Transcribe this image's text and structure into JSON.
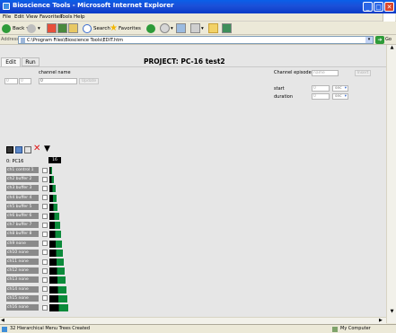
{
  "window": {
    "title": "Bioscience Tools - Microsoft Internet Explorer"
  },
  "menu": [
    "File",
    "Edit",
    "View",
    "Favorites",
    "Tools",
    "Help"
  ],
  "toolbar": {
    "back": "Back",
    "search": "Search",
    "favorites": "Favorites"
  },
  "address": {
    "label": "Address",
    "url": "C:\\Program Files\\Bioscience Tools\\EDIT.htm",
    "go": "Go",
    "links": "Links"
  },
  "tabs": [
    {
      "label": "Edit"
    },
    {
      "label": "Run"
    }
  ],
  "project_title": "PROJECT: PC-16 test2",
  "channel": {
    "name_label": "channel name",
    "field1": "0",
    "field2": "0",
    "field3": "0",
    "update_button": "Update"
  },
  "episode": {
    "label": "Channel episode",
    "name_placeholder": "name",
    "insert_button": "Insert",
    "start_label": "start",
    "start_value": "0",
    "duration_label": "duration",
    "duration_value": "0",
    "unit": "sec"
  },
  "tree": {
    "root_label": "0: PC16",
    "root_badge": "16",
    "channels": [
      {
        "label": "ch1 control 1",
        "level": 0.15
      },
      {
        "label": "ch2 buffer 2",
        "level": 0.22
      },
      {
        "label": "ch3 buffer 3",
        "level": 0.3
      },
      {
        "label": "ch4 buffer 4",
        "level": 0.36
      },
      {
        "label": "ch5 buffer 5",
        "level": 0.42
      },
      {
        "label": "ch6 buffer 6",
        "level": 0.48
      },
      {
        "label": "ch7 buffer 7",
        "level": 0.54
      },
      {
        "label": "ch8 buffer 8",
        "level": 0.6
      },
      {
        "label": "ch9 none",
        "level": 0.65
      },
      {
        "label": "ch10 none",
        "level": 0.7
      },
      {
        "label": "ch11 none",
        "level": 0.74
      },
      {
        "label": "ch12 none",
        "level": 0.78
      },
      {
        "label": "ch13 none",
        "level": 0.82
      },
      {
        "label": "ch14 none",
        "level": 0.86
      },
      {
        "label": "ch15 none",
        "level": 0.9
      },
      {
        "label": "ch16 none",
        "level": 0.95
      }
    ]
  },
  "status": {
    "text": "32 Hierarchical Menu Trees Created",
    "zone": "My Computer"
  },
  "colors": {
    "titlebar": "#0A3CC6",
    "channel_bar_fill": "#0b8a3a",
    "channel_label_bg": "#8a8a8a"
  }
}
